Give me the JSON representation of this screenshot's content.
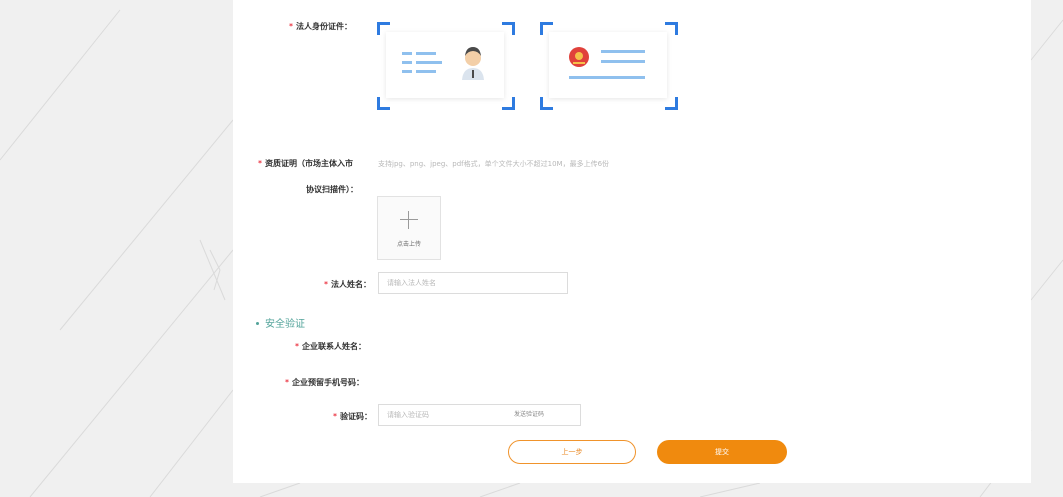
{
  "form": {
    "legal_id": {
      "label": "法人身份证件："
    },
    "qualification": {
      "label_line1": "资质证明（市场主体入市",
      "label_line2": "协议扫描件）：",
      "hint": "支持jpg、png、jpeg、pdf格式，单个文件大小不超过10M，最多上传6份",
      "upload_label": "点击上传"
    },
    "legal_name": {
      "label": "法人姓名：",
      "placeholder": "请输入法人姓名",
      "value": ""
    }
  },
  "security": {
    "title": "安全验证",
    "contact_name": {
      "label": "企业联系人姓名："
    },
    "phone": {
      "label": "企业预留手机号码："
    },
    "code": {
      "label": "验证码：",
      "placeholder": "请输入验证码",
      "value": "",
      "send_label": "发送验证码"
    }
  },
  "actions": {
    "prev_label": "上一步",
    "submit_label": "提交"
  },
  "colors": {
    "required": "#e60012",
    "corner_blue": "#2e7be0",
    "section_teal": "#52a39a",
    "accent_orange": "#f08a0e"
  },
  "required_mark": "*"
}
